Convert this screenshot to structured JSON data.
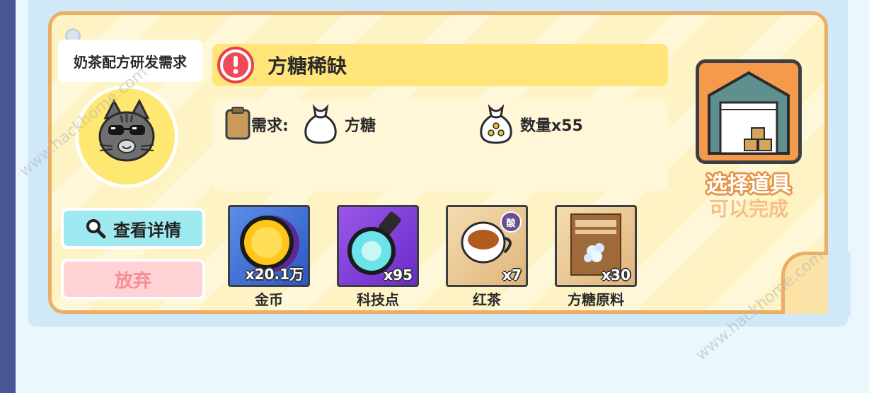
{
  "panel": {
    "title": "奶茶配方研发需求",
    "alert_title": "方糖稀缺"
  },
  "requirement": {
    "need_label": "需求:",
    "item_name": "方糖",
    "quantity_text": "数量x55"
  },
  "buttons": {
    "details": "查看详情",
    "give_up": "放弃"
  },
  "rewards": [
    {
      "name": "金币",
      "count": "x20.1万",
      "icon": "gold-coin-icon"
    },
    {
      "name": "科技点",
      "count": "x95",
      "icon": "tech-potion-icon"
    },
    {
      "name": "红茶",
      "count": "x7",
      "icon": "black-tea-icon",
      "badge": "酸"
    },
    {
      "name": "方糖原料",
      "count": "x30",
      "icon": "sugar-bag-icon"
    }
  ],
  "action": {
    "select_tool": "选择道具",
    "status": "可以完成"
  },
  "watermarks": [
    "www.hackhome.com",
    "www.hackhome.com"
  ],
  "colors": {
    "card_bg": "#fdf3c4",
    "card_border": "#eaae66",
    "title_bar": "#ffe57a",
    "details_btn": "#9eeaf0",
    "giveup_btn": "#ffd3d6",
    "warehouse": "#f59a4b"
  }
}
